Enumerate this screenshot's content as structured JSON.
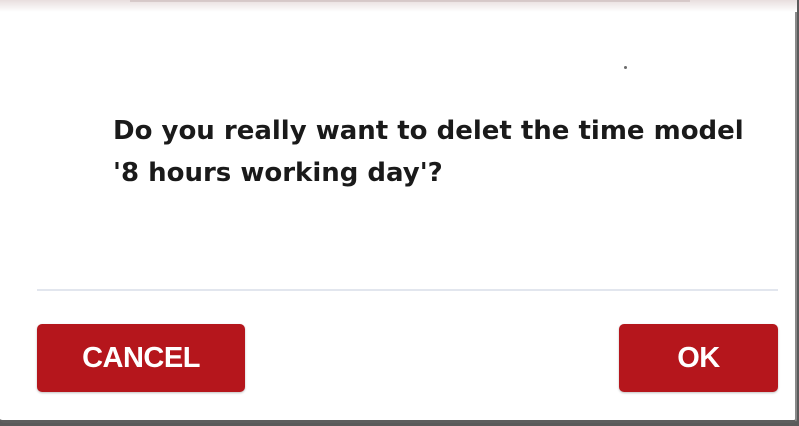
{
  "dialog": {
    "message": "Do you really want to delet the time model '8 hours working day'?",
    "buttons": {
      "cancel_label": "CANCEL",
      "ok_label": "OK"
    }
  },
  "colors": {
    "button_background": "#b5161c",
    "button_text": "#ffffff",
    "message_text": "#1a1a1a",
    "divider": "#e2e6ee"
  }
}
